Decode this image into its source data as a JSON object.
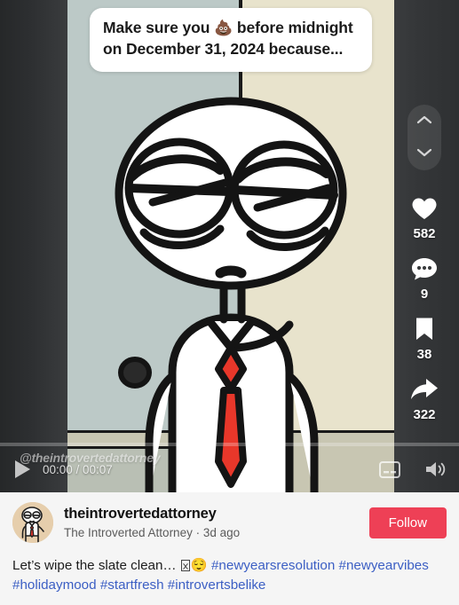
{
  "video": {
    "overlay_caption": {
      "line1_before_emoji": "Make sure you ",
      "emoji": "💩",
      "line1_after_emoji": " before midnight",
      "line2": "on  December 31, 2024 because..."
    },
    "watermark": "@theintrovertedattorney",
    "scene_colors": {
      "wall_left": "#bcc9c7",
      "wall_right": "#e8e3cc",
      "floor": "#c8c6b2",
      "tie": "#e8372a",
      "outline": "#141414"
    }
  },
  "action_rail": {
    "nav_up_icon": "chevron-up-icon",
    "nav_down_icon": "chevron-down-icon",
    "items": [
      {
        "icon": "heart-icon",
        "count": "582"
      },
      {
        "icon": "comment-icon",
        "count": "9"
      },
      {
        "icon": "bookmark-icon",
        "count": "38"
      },
      {
        "icon": "share-icon",
        "count": "322"
      }
    ]
  },
  "player": {
    "play_icon": "play-icon",
    "time": "00:00 / 00:07",
    "progress_percent": 0,
    "cc_icon": "closed-captions-icon",
    "volume_icon": "volume-icon"
  },
  "info": {
    "handle": "theintrovertedattorney",
    "display_name_and_time": "The Introverted Attorney · 3d ago",
    "follow_label": "Follow",
    "caption_text": "Let’s wipe the slate clean… ",
    "caption_emoji": "😌",
    "hashtags": [
      "#newyearsresolution",
      "#newyearvibes",
      "#holidaymood",
      "#startfresh",
      "#introvertsbelike"
    ],
    "accent_color": "#ee4056",
    "hashtag_color": "#3c5fc4"
  }
}
